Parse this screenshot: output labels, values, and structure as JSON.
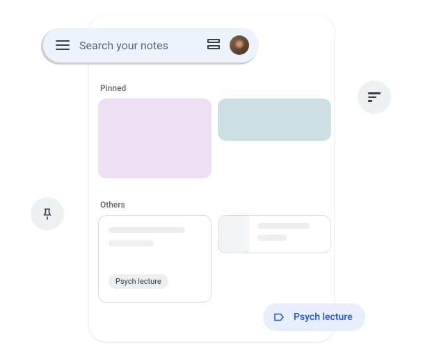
{
  "search": {
    "placeholder": "Search your notes"
  },
  "sections": {
    "pinned": "Pinned",
    "others": "Others"
  },
  "notes": {
    "other1": {
      "tag": "Psych lecture"
    }
  },
  "labelPill": {
    "text": "Psych lecture"
  }
}
